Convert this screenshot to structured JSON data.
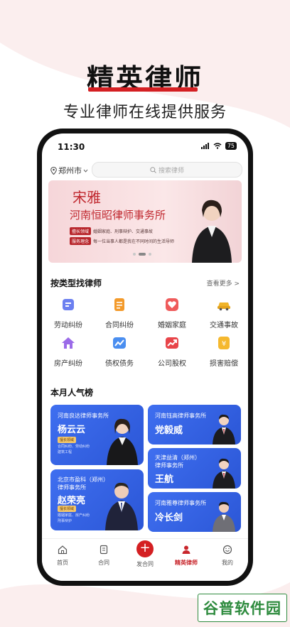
{
  "promo": {
    "title": "精英律师",
    "subtitle": "专业律师在线提供服务"
  },
  "status_bar": {
    "time": "11:30",
    "battery": "75"
  },
  "location": {
    "city": "郑州市"
  },
  "search": {
    "placeholder": "搜索律师"
  },
  "banner": {
    "name": "宋雅",
    "firm": "河南恒昭律师事务所",
    "field_tag": "擅长领域",
    "field_text": "婚姻家庭、刑事辩护、交通事故",
    "idea_tag": "服务理念",
    "idea_text": "每一位当事人都是我在不同时间的生活导师",
    "page_index": 2,
    "page_count": 3
  },
  "categories_section": {
    "title": "按类型找律师",
    "see_more": "查看更多 >",
    "items": [
      {
        "label": "劳动纠纷",
        "icon": "labor-dispute-icon",
        "color": "#6b7ff0"
      },
      {
        "label": "合同纠纷",
        "icon": "contract-dispute-icon",
        "color": "#f39a2b"
      },
      {
        "label": "婚姻家庭",
        "icon": "marriage-family-icon",
        "color": "#ef5b5b"
      },
      {
        "label": "交通事故",
        "icon": "traffic-accident-icon",
        "color": "#f0b429"
      },
      {
        "label": "房产纠纷",
        "icon": "property-dispute-icon",
        "color": "#9b6be8"
      },
      {
        "label": "债权债务",
        "icon": "debt-icon",
        "color": "#4a8ef0"
      },
      {
        "label": "公司股权",
        "icon": "company-equity-icon",
        "color": "#e8454a"
      },
      {
        "label": "损害赔偿",
        "icon": "damage-compensation-icon",
        "color": "#f5b82e"
      }
    ]
  },
  "ranking": {
    "title": "本月人气榜",
    "cards": [
      {
        "firm": "河南良达律师事务所",
        "name": "杨云云",
        "tag": "擅长领域",
        "desc": "合同纠纷、劳动纠纷\n建筑工程"
      },
      {
        "firm": "河南钰高律师事务所",
        "name": "党毅威"
      },
      {
        "firm": "天津益清（郑州）\n律师事务所",
        "name": "王航"
      },
      {
        "firm": "北京市盈科（郑州）\n律师事务所",
        "name": "赵荣亮",
        "tag": "擅长领域",
        "desc": "婚姻家庭、房产纠纷\n刑事辩护"
      },
      {
        "firm": "河南雅尊律师事务所",
        "name": "冷长剑"
      }
    ]
  },
  "tabbar": {
    "items": [
      {
        "label": "首页",
        "icon": "home-icon"
      },
      {
        "label": "合同",
        "icon": "contract-icon"
      },
      {
        "label": "发合同",
        "icon": "plus-icon"
      },
      {
        "label": "精英律师",
        "icon": "lawyer-icon",
        "active": true
      },
      {
        "label": "我的",
        "icon": "profile-icon"
      }
    ]
  },
  "watermark": {
    "text": "谷普软件园"
  },
  "colors": {
    "accent": "#d41f22",
    "card_blue": "#3562e6"
  }
}
